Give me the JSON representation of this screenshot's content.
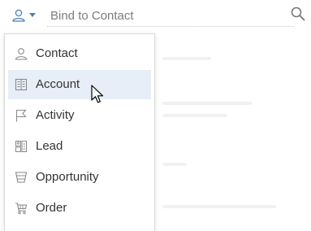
{
  "lookup": {
    "entity_icon": "person-icon",
    "placeholder": "Bind to Contact",
    "search_icon": "search-icon"
  },
  "menu": {
    "items": [
      {
        "label": "Contact",
        "icon": "person-icon",
        "highlighted": false
      },
      {
        "label": "Account",
        "icon": "building-icon",
        "highlighted": true
      },
      {
        "label": "Activity",
        "icon": "flag-icon",
        "highlighted": false
      },
      {
        "label": "Lead",
        "icon": "lead-card-icon",
        "highlighted": false
      },
      {
        "label": "Opportunity",
        "icon": "funnel-icon",
        "highlighted": false
      },
      {
        "label": "Order",
        "icon": "cart-icon",
        "highlighted": false
      }
    ]
  },
  "colors": {
    "icon": "#8a8a8a",
    "accent": "#4a7fb8",
    "highlight": "#e8eef8",
    "text": "#333333"
  }
}
